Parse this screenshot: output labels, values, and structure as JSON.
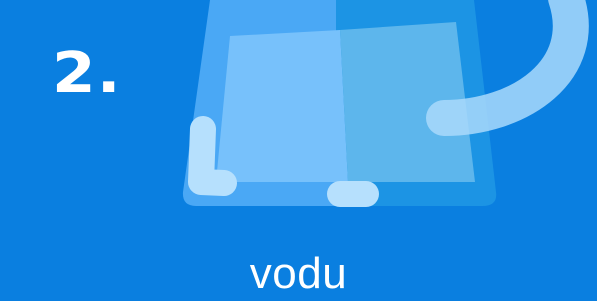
{
  "step": {
    "number_label": "2."
  },
  "illustration": {
    "icon": "container-water-icon",
    "colors": {
      "background": "#0a7fe0",
      "container_left": "#4aa8f5",
      "container_right": "#1c94e4",
      "water_left": "#77c1fb",
      "water_right": "#5db6ec",
      "handle": "#a9d9fb",
      "base_marks": "#b6e0fd"
    }
  },
  "caption": {
    "text": "vodu"
  }
}
